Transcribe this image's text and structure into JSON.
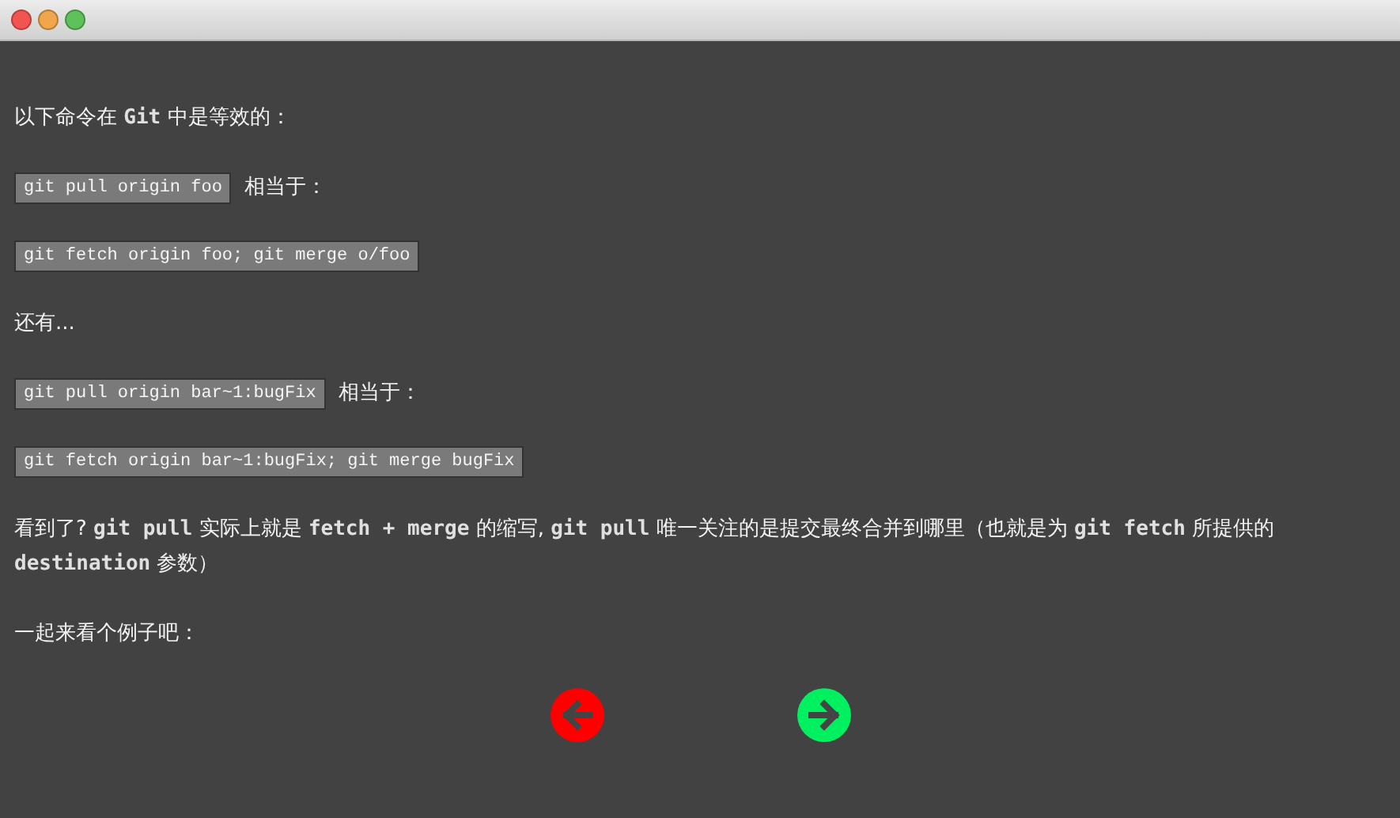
{
  "paragraphs": [
    {
      "kind": "text",
      "text": "以下命令在 **Git** 中是等效的："
    },
    {
      "kind": "code",
      "code": "git pull origin foo",
      "text": "相当于："
    },
    {
      "kind": "code",
      "code": "git fetch origin foo; git merge o/foo"
    },
    {
      "kind": "text",
      "text": "还有..."
    },
    {
      "kind": "code",
      "code": "git pull origin bar~1:bugFix",
      "text": "相当于："
    },
    {
      "kind": "code",
      "code": "git fetch origin bar~1:bugFix; git merge bugFix"
    },
    {
      "kind": "text",
      "text": "看到了? **git pull** 实际上就是 **fetch + merge** 的缩写, **git pull** 唯一关注的是提交最终合并到哪里（也就是为 **git fetch** 所提供的 **destination** 参数）"
    },
    {
      "kind": "text",
      "text": "一起来看个例子吧："
    }
  ],
  "nav": [
    {
      "kind": "back"
    },
    {
      "kind": "forward"
    }
  ]
}
